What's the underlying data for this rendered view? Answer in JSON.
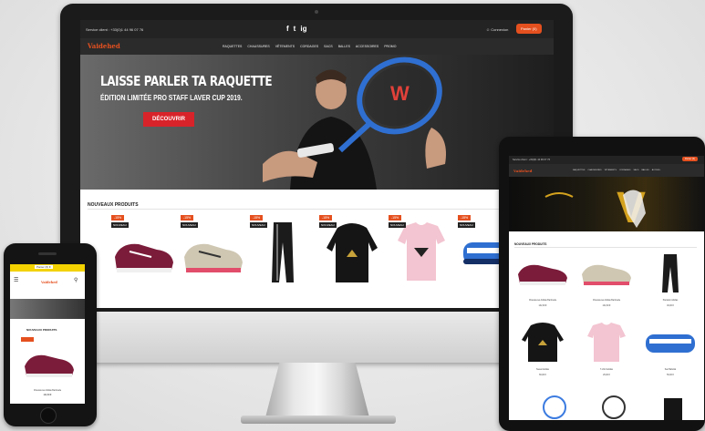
{
  "desktop": {
    "topbar": {
      "service": "Service client : +33(0)1 44 96 07 76",
      "social": [
        "f",
        "t",
        "ig"
      ],
      "account_label": "Connexion",
      "cart_label": "Panier (0)"
    },
    "nav": {
      "logo": "Vaidehed",
      "menu": [
        "RAQUETTES",
        "CHAUSSURES",
        "VÊTEMENTS",
        "CORDAGES",
        "SACS",
        "BALLES",
        "ACCESSOIRES",
        "PROMO"
      ]
    },
    "hero": {
      "title": "LAISSE PARLER TA RAQUETTE",
      "subtitle": "ÉDITION LIMITÉE PRO STAFF LAVER CUP 2019.",
      "cta": "DÉCOUVRIR",
      "racket_brand": "W"
    },
    "section_title": "NOUVEAUX PRODUITS",
    "products": [
      {
        "tag": "-15%",
        "badge": "NOUVEAU",
        "kind": "shoe-burgundy"
      },
      {
        "tag": "-15%",
        "badge": "NOUVEAU",
        "kind": "shoe-beige"
      },
      {
        "tag": "-15%",
        "badge": "NOUVEAU",
        "kind": "pants"
      },
      {
        "tag": "-15%",
        "badge": "NOUVEAU",
        "kind": "hoodie"
      },
      {
        "tag": "-15%",
        "badge": "NOUVEAU",
        "kind": "tshirt"
      },
      {
        "tag": "-15%",
        "badge": "NOUVEAU",
        "kind": "bag"
      }
    ]
  },
  "tablet": {
    "service": "Service client : +33(0)1 44 96 07 76",
    "cart_label": "Panier (0)",
    "logo": "Vaidehed",
    "menu": [
      "RAQUETTES",
      "CHAUSSURES",
      "VÊTEMENTS",
      "CORDAGES",
      "SACS",
      "BALLES",
      "ACCESS."
    ],
    "hero_letter": "V",
    "section_title": "NOUVEAUX PRODUITS",
    "items": [
      {
        "name": "Chaussures Adidas Barricade",
        "price": "132,00 €"
      },
      {
        "name": "Chaussures Adidas Barricade",
        "price": "132,00 €"
      },
      {
        "name": "Pantalon Adidas",
        "price": "49,00 €"
      },
      {
        "name": "Sweat Adidas",
        "price": "69,00 €"
      },
      {
        "name": "T-shirt Adidas",
        "price": "29,00 €"
      },
      {
        "name": "Sac Babolat",
        "price": "59,00 €"
      }
    ]
  },
  "phone": {
    "bar": "Panier (0) €",
    "logo": "Vaidehed",
    "section_title": "NOUVEAUX PRODUITS",
    "product_name": "Chaussures Adidas Barricade",
    "product_price": "132,00 €"
  },
  "colors": {
    "accent": "#e5501f",
    "cta_red": "#d8232a",
    "dark": "#232323"
  }
}
